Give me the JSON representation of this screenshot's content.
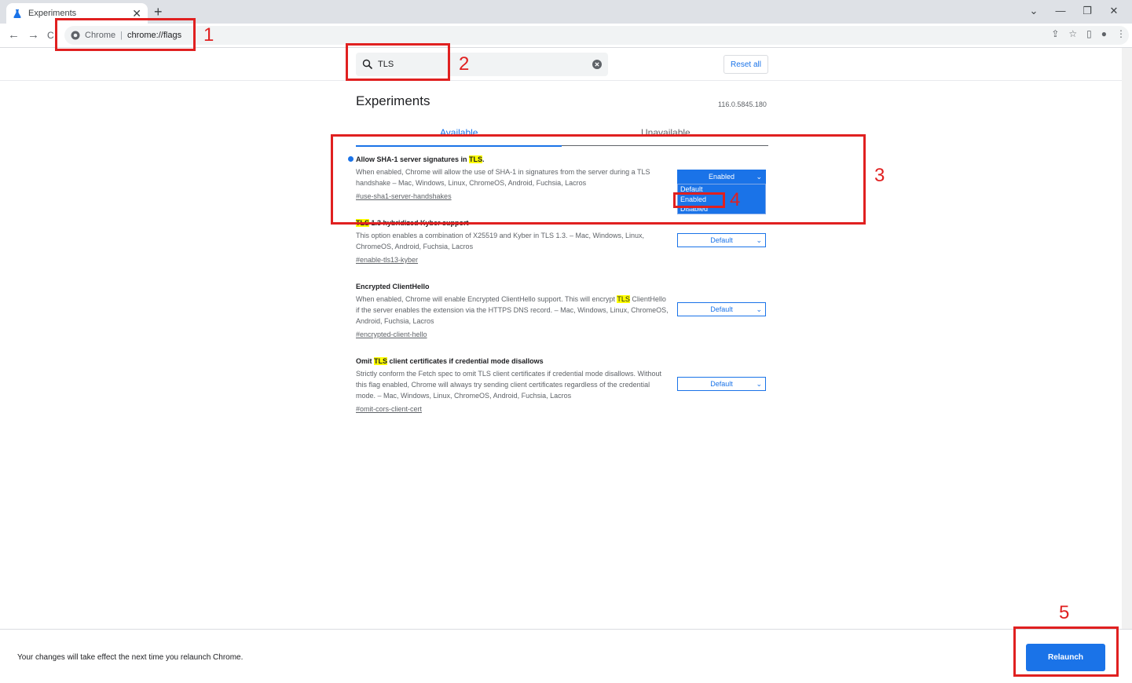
{
  "browser": {
    "tab_title": "Experiments",
    "tab_close": "✕",
    "new_tab": "+",
    "window_controls": [
      "⌄",
      "—",
      "❐",
      "✕"
    ],
    "nav": {
      "back": "←",
      "forward": "→",
      "reload": "C"
    },
    "omnibox": {
      "origin": "Chrome",
      "separator": "|",
      "path": "chrome://flags"
    },
    "toolbar_icons": [
      "share-icon",
      "star-icon",
      "side-panel-icon",
      "profile-icon",
      "menu-icon"
    ]
  },
  "search": {
    "value": "TLS"
  },
  "reset_label": "Reset all",
  "page_title": "Experiments",
  "version": "116.0.5845.180",
  "tabs": {
    "available": "Available",
    "unavailable": "Unavailable"
  },
  "flags": [
    {
      "name_before": "Allow SHA-1 server signatures in ",
      "name_highlight": "TLS",
      "name_after": ".",
      "description": "When enabled, Chrome will allow the use of SHA-1 in signatures from the server during a TLS handshake – Mac, Windows, Linux, ChromeOS, Android, Fuchsia, Lacros",
      "link": "#use-sha1-server-handshakes",
      "selected": "Enabled"
    },
    {
      "name_before": "",
      "name_highlight": "TLS",
      "name_after": " 1.3 hybridized Kyber support",
      "description": "This option enables a combination of X25519 and Kyber in TLS 1.3. – Mac, Windows, Linux, ChromeOS, Android, Fuchsia, Lacros",
      "link": "#enable-tls13-kyber",
      "selected": "Default"
    },
    {
      "name_before": "Encrypted ClientHello",
      "name_highlight": "",
      "name_after": "",
      "description_before": "When enabled, Chrome will enable Encrypted ClientHello support. This will encrypt ",
      "description_highlight": "TLS",
      "description_after": " ClientHello if the server enables the extension via the HTTPS DNS record. – Mac, Windows, Linux, ChromeOS, Android, Fuchsia, Lacros",
      "link": "#encrypted-client-hello",
      "selected": "Default"
    },
    {
      "name_before": "Omit ",
      "name_highlight": "TLS",
      "name_after": " client certificates if credential mode disallows",
      "description": "Strictly conform the Fetch spec to omit TLS client certificates if credential mode disallows. Without this flag enabled, Chrome will always try sending client certificates regardless of the credential mode. – Mac, Windows, Linux, ChromeOS, Android, Fuchsia, Lacros",
      "link": "#omit-cors-client-cert",
      "selected": "Default"
    }
  ],
  "dropdown_options": [
    "Default",
    "Enabled",
    "Disabled"
  ],
  "footer": {
    "message": "Your changes will take effect the next time you relaunch Chrome.",
    "relaunch_label": "Relaunch"
  },
  "annotations": [
    "1",
    "2",
    "3",
    "4",
    "5"
  ],
  "colors": {
    "accent": "#1a73e8",
    "annotation": "#e02020",
    "highlight": "#ffff00"
  }
}
